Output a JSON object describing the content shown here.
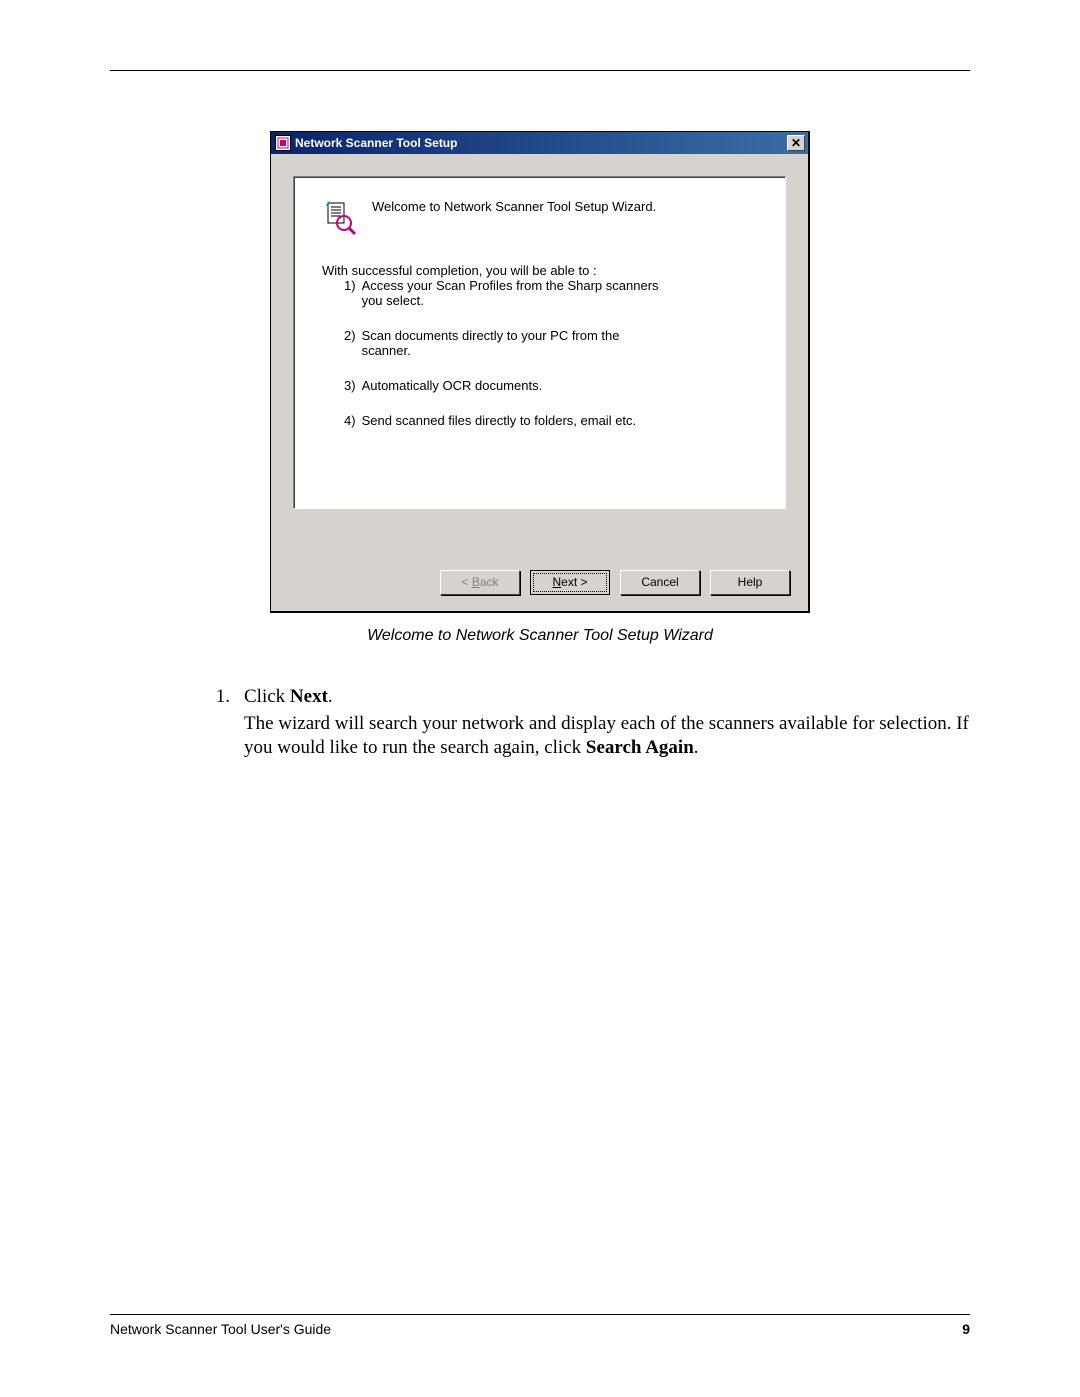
{
  "dialog": {
    "title": "Network Scanner Tool Setup",
    "close_symbol": "✕",
    "welcome": "Welcome to Network Scanner Tool Setup Wizard.",
    "intro": "With successful completion, you will be able to :",
    "features": [
      {
        "num": "1)",
        "text": "Access your Scan Profiles from the Sharp scanners you select."
      },
      {
        "num": "2)",
        "text": "Scan documents directly to your PC from the scanner."
      },
      {
        "num": "3)",
        "text": "Automatically OCR documents."
      },
      {
        "num": "4)",
        "text": "Send scanned files directly to folders, email etc."
      }
    ],
    "buttons": {
      "back_prefix": "< ",
      "back_u": "B",
      "back_suffix": "ack",
      "next_u": "N",
      "next_suffix": "ext >",
      "cancel": "Cancel",
      "help": "Help"
    }
  },
  "caption": "Welcome to Network Scanner Tool Setup Wizard",
  "doc": {
    "step_num": "1.",
    "step_prefix": "Click ",
    "step_bold": "Next",
    "step_suffix": ".",
    "para_a": "The wizard will search your network and display each of the scanners available for selection. If you would like to run the search again, click ",
    "para_bold": "Search Again",
    "para_b": "."
  },
  "footer": {
    "left": "Network Scanner Tool User's Guide",
    "page": "9"
  }
}
